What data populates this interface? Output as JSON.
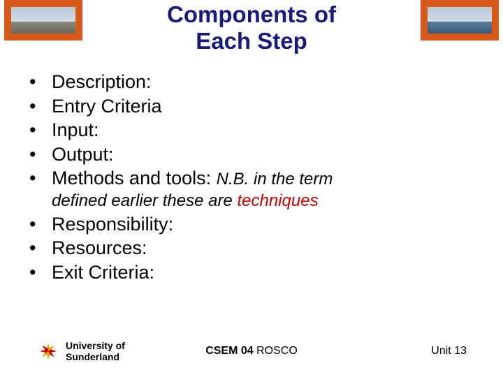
{
  "title_line1": "Components of",
  "title_line2": "Each Step",
  "bullets": {
    "b0": "Description:",
    "b1": "Entry Criteria",
    "b2": "Input:",
    "b3": "Output:",
    "b4_a": "Methods and tools: ",
    "b4_note": "N.B. in the term",
    "b4_cont_a": "defined earlier these are ",
    "b4_cont_b": "techniques",
    "b5": "Responsibility:",
    "b6": "Resources:",
    "b7": "Exit Criteria:"
  },
  "footer": {
    "uni_line1": "University of",
    "uni_line2": "Sunderland",
    "course_bold": "CSEM 04",
    "course_rest": " ROSCO",
    "unit": "Unit 13"
  }
}
